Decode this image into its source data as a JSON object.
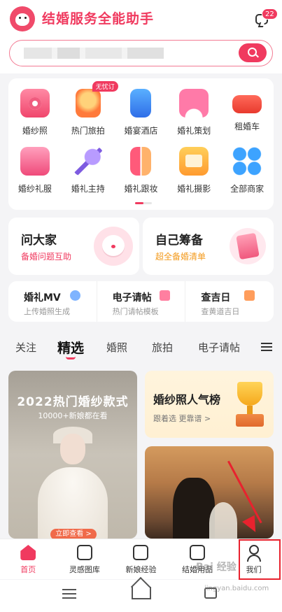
{
  "header": {
    "app_title": "结婚服务全能助手",
    "message_badge": "22",
    "search_placeholder": ""
  },
  "categories": [
    {
      "label": "婚纱照",
      "icon": "camera-icon"
    },
    {
      "label": "热门旅拍",
      "icon": "hot-air-balloon-icon",
      "tag": "无忧订"
    },
    {
      "label": "婚宴酒店",
      "icon": "hotel-building-icon"
    },
    {
      "label": "婚礼策划",
      "icon": "flower-arch-icon"
    },
    {
      "label": "租婚车",
      "icon": "car-icon"
    },
    {
      "label": "婚纱礼服",
      "icon": "wedding-dress-icon"
    },
    {
      "label": "婚礼主持",
      "icon": "microphone-icon"
    },
    {
      "label": "婚礼跟妆",
      "icon": "lipstick-icon"
    },
    {
      "label": "婚礼摄影",
      "icon": "photo-frame-icon"
    },
    {
      "label": "全部商家",
      "icon": "grid-all-icon"
    }
  ],
  "promos": {
    "left": {
      "title": "问大家",
      "subtitle": "备婚问题互助"
    },
    "right": {
      "title": "自己筹备",
      "subtitle": "超全备婚清单"
    }
  },
  "tools": [
    {
      "title": "婚礼MV",
      "subtitle": "上传婚照生成"
    },
    {
      "title": "电子请帖",
      "subtitle": "热门请帖模板"
    },
    {
      "title": "查吉日",
      "subtitle": "查黄道吉日"
    }
  ],
  "feed_tabs": [
    "关注",
    "精选",
    "婚照",
    "旅拍",
    "电子请帖"
  ],
  "feed_active_tab": "精选",
  "feed": {
    "card1": {
      "title": "2022热门婚纱款式",
      "subtitle": "10000+新娘都在看",
      "cta": "立即查看 >"
    },
    "card2": {
      "title": "婚纱照人气榜",
      "subtitle": "跟着选 更靠谱 >"
    }
  },
  "bottom_nav": [
    {
      "label": "首页",
      "active": true
    },
    {
      "label": "灵感图库",
      "active": false
    },
    {
      "label": "新娘经验",
      "active": false
    },
    {
      "label": "结婚用品",
      "active": false
    },
    {
      "label": "我们",
      "active": false
    }
  ],
  "watermark": "Bai 经验",
  "watermark_url": "jingyan.baidu.com",
  "colors": {
    "brand": "#f03a5f",
    "annotation": "#e8222e"
  }
}
